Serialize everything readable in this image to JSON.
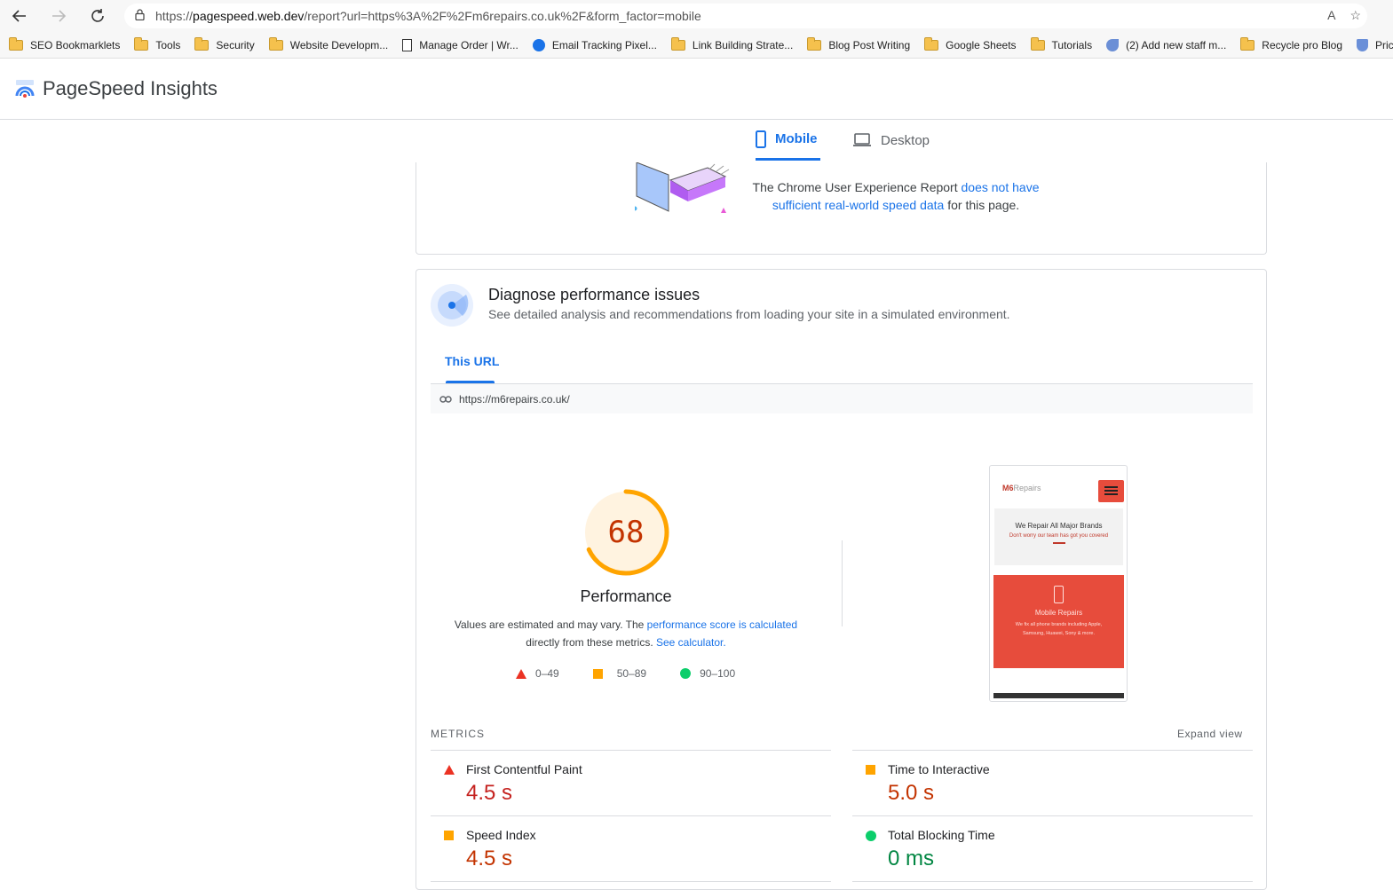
{
  "browser": {
    "url_prefix": "https://",
    "url_host": "pagespeed.web.dev",
    "url_rest": "/report?url=https%3A%2F%2Fm6repairs.co.uk%2F&form_factor=mobile",
    "read_aloud": "A",
    "bookmarks": [
      {
        "label": "SEO Bookmarklets",
        "icon": "folder-icon"
      },
      {
        "label": "Tools",
        "icon": "folder-icon"
      },
      {
        "label": "Security",
        "icon": "folder-icon"
      },
      {
        "label": "Website Developm...",
        "icon": "folder-icon"
      },
      {
        "label": "Manage Order | Wr...",
        "icon": "page-icon"
      },
      {
        "label": "Email Tracking Pixel...",
        "icon": "circle-icon"
      },
      {
        "label": "Link Building Strate...",
        "icon": "folder-icon"
      },
      {
        "label": "Blog Post Writing",
        "icon": "folder-icon"
      },
      {
        "label": "Google Sheets",
        "icon": "folder-icon"
      },
      {
        "label": "Tutorials",
        "icon": "folder-icon"
      },
      {
        "label": "(2) Add new staff m...",
        "icon": "bird-icon"
      },
      {
        "label": "Recycle pro Blog",
        "icon": "folder-icon"
      },
      {
        "label": "Price",
        "icon": "shield-icon"
      }
    ]
  },
  "header": {
    "title": "PageSpeed Insights"
  },
  "device_tabs": {
    "mobile": "Mobile",
    "desktop": "Desktop"
  },
  "crux": {
    "text_before": "The Chrome User Experience Report ",
    "link_text": "does not have sufficient real-world speed data",
    "text_after": " for this page."
  },
  "diagnose": {
    "title": "Diagnose performance issues",
    "subtitle": "See detailed analysis and recommendations from loading your site in a simulated environment.",
    "tab": "This URL",
    "url": "https://m6repairs.co.uk/"
  },
  "score": {
    "value": "68",
    "fraction": 0.68,
    "color": "#ffa400",
    "label": "Performance",
    "note_1": "Values are estimated and may vary. The ",
    "note_link_1": "performance score is calculated",
    "note_2": " directly from these metrics. ",
    "note_link_2": "See calculator.",
    "legend": {
      "poor": "0–49",
      "average": "50–89",
      "good": "90–100"
    }
  },
  "preview": {
    "logo_main": "M6",
    "logo_sub": "Repairs",
    "hero_title": "We Repair All Major Brands",
    "hero_sub": "Don't worry our team has got you covered",
    "card_title": "Mobile Repairs",
    "card_text": "We fix all phone brands including Apple, Samsung, Huawei, Sony & more."
  },
  "metrics": {
    "heading": "METRICS",
    "expand": "Expand view",
    "items": [
      {
        "label": "First Contentful Paint",
        "value": "4.5 s",
        "rating": "poor"
      },
      {
        "label": "Time to Interactive",
        "value": "5.0 s",
        "rating": "average"
      },
      {
        "label": "Speed Index",
        "value": "4.5 s",
        "rating": "average"
      },
      {
        "label": "Total Blocking Time",
        "value": "0 ms",
        "rating": "good"
      }
    ]
  }
}
